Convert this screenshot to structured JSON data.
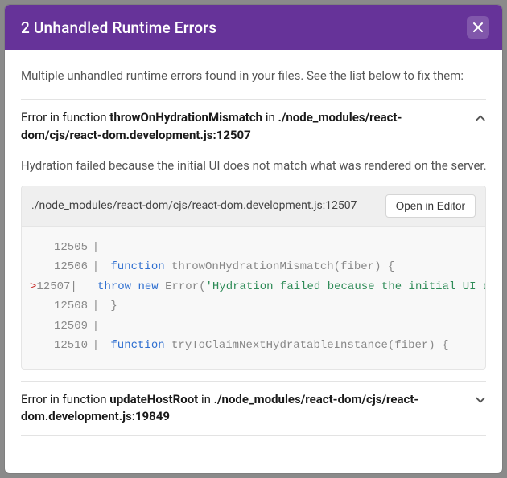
{
  "header": {
    "title": "2 Unhandled Runtime Errors"
  },
  "intro": "Multiple unhandled runtime errors found in your files. See the list below to fix them:",
  "errors": [
    {
      "prefix": "Error in function ",
      "fn": "throwOnHydrationMismatch",
      "mid": " in ",
      "loc": "./node_modules/react-dom/cjs/react-dom.development.js:12507",
      "expanded": true,
      "message": "Hydration failed because the initial UI does not match what was rendered on the server.",
      "file": "./node_modules/react-dom/cjs/react-dom.development.js:12507",
      "open_label": "Open in Editor",
      "code": {
        "mark": ">",
        "lines": [
          {
            "n": "12505",
            "m": " ",
            "seg": [
              {
                "t": "",
                "c": "code-text"
              }
            ]
          },
          {
            "n": "12506",
            "m": " ",
            "seg": [
              {
                "t": "function",
                "c": "kw"
              },
              {
                "t": " throwOnHydrationMismatch(fiber) {",
                "c": "code-text"
              }
            ]
          },
          {
            "n": "12507",
            "m": ">",
            "seg": [
              {
                "t": "  ",
                "c": "code-text"
              },
              {
                "t": "throw",
                "c": "kw"
              },
              {
                "t": " ",
                "c": "code-text"
              },
              {
                "t": "new",
                "c": "kw"
              },
              {
                "t": " Error(",
                "c": "code-text"
              },
              {
                "t": "'Hydration failed because the initial UI does not match what was rendered on the server.'",
                "c": "str"
              },
              {
                "t": ");",
                "c": "code-text"
              }
            ]
          },
          {
            "n": "12508",
            "m": " ",
            "seg": [
              {
                "t": "}",
                "c": "code-text"
              }
            ]
          },
          {
            "n": "12509",
            "m": " ",
            "seg": [
              {
                "t": "",
                "c": "code-text"
              }
            ]
          },
          {
            "n": "12510",
            "m": " ",
            "seg": [
              {
                "t": "function",
                "c": "kw"
              },
              {
                "t": " tryToClaimNextHydratableInstance(fiber) {",
                "c": "code-text"
              }
            ]
          }
        ]
      }
    },
    {
      "prefix": "Error in function ",
      "fn": "updateHostRoot",
      "mid": " in ",
      "loc": "./node_modules/react-dom/cjs/react-dom.development.js:19849",
      "expanded": false
    }
  ]
}
